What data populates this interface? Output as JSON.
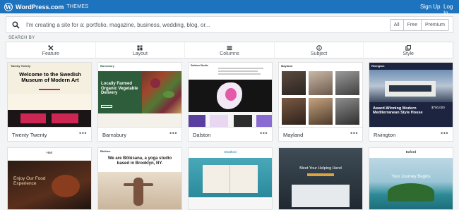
{
  "topbar": {
    "brand_name": "WordPress.com",
    "brand_sub": "THEMES",
    "signup_label": "Sign Up",
    "login_label": "Log In",
    "colors": {
      "bar": "#1e73be"
    }
  },
  "search": {
    "icon": "search-icon",
    "placeholder": "I'm creating a site for a: portfolio, magazine, business, wedding, blog, or...",
    "segments": [
      "All",
      "Free",
      "Premium"
    ]
  },
  "search_by": {
    "label": "SEARCH BY",
    "filters": [
      {
        "label": "Feature",
        "icon": "tools-icon"
      },
      {
        "label": "Layout",
        "icon": "layout-icon"
      },
      {
        "label": "Columns",
        "icon": "columns-icon"
      },
      {
        "label": "Subject",
        "icon": "info-icon"
      },
      {
        "label": "Style",
        "icon": "style-icon"
      }
    ]
  },
  "themes_row1": [
    {
      "name": "Twenty Twenty",
      "preview": {
        "site_title": "Twenty Twenty",
        "headline": "Welcome to the Swedish Museum of Modern Art",
        "colors": {
          "accent": "#cd2653",
          "dark": "#1c1518"
        }
      }
    },
    {
      "name": "Barnsbury",
      "preview": {
        "site_title": "Barnsbury",
        "headline": "Locally Farmed Organic Vegetable Delivery",
        "colors": {
          "panel": "#2e5d3b"
        }
      }
    },
    {
      "name": "Dalston",
      "preview": {
        "site_title": "Dalston Studio",
        "colors": {
          "dark": "#141414"
        }
      }
    },
    {
      "name": "Mayland",
      "preview": {
        "site_title": "Mayland"
      }
    },
    {
      "name": "Rivington",
      "preview": {
        "site_title": "Rivington",
        "headline": "Award-Winning Modern Mediterranean Style House",
        "price": "$700,000",
        "colors": {
          "dark": "#1c2440"
        }
      }
    }
  ],
  "themes_row2": [
    {
      "preview": {
        "site_title": "Hari",
        "headline": "Enjoy Our Food Experience"
      }
    },
    {
      "preview": {
        "site_title": "Bleiben",
        "headline": "We are Bölúsana, a yoga studio based in Brooklyn, NY."
      }
    },
    {
      "preview": {
        "site_title": "Stratford"
      }
    },
    {
      "preview": {
        "headline": "Meet Your Helping Hand"
      }
    },
    {
      "preview": {
        "site_title": "Exford",
        "headline": "Your Journey Begins"
      }
    }
  ],
  "more_label": "•••"
}
